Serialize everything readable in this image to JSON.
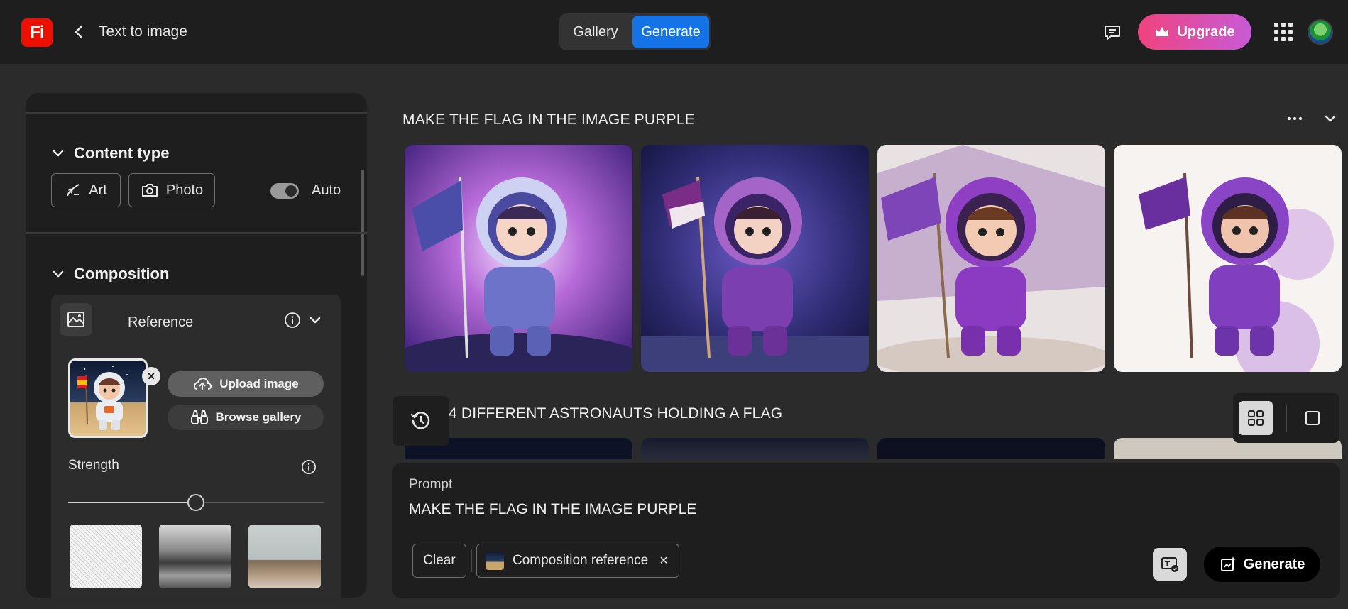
{
  "app": {
    "logo_text": "Fi",
    "page_title": "Text to image",
    "brand_color": "#eb1000",
    "accent_color": "#1473e6"
  },
  "header": {
    "tabs": [
      {
        "label": "Gallery",
        "active": false
      },
      {
        "label": "Generate",
        "active": true
      }
    ],
    "upgrade_label": "Upgrade",
    "icons": [
      "back-chevron-icon",
      "feedback-icon",
      "crown-icon",
      "apps-grid-icon",
      "avatar"
    ]
  },
  "sidebar": {
    "content_type": {
      "heading": "Content type",
      "buttons": [
        {
          "label": "Art",
          "icon": "brush-icon"
        },
        {
          "label": "Photo",
          "icon": "camera-icon"
        }
      ],
      "auto_label": "Auto",
      "auto_enabled": true
    },
    "composition": {
      "heading": "Composition",
      "reference": {
        "title": "Reference",
        "upload_label": "Upload image",
        "browse_label": "Browse gallery"
      },
      "strength": {
        "label": "Strength",
        "value": 0.5
      }
    }
  },
  "results": {
    "rows": [
      {
        "prompt": "MAKE THE FLAG IN THE IMAGE PURPLE"
      },
      {
        "prompt": "4 DIFFERENT ASTRONAUTS HOLDING A FLAG"
      }
    ]
  },
  "prompt_bar": {
    "label": "Prompt",
    "value": "MAKE THE FLAG IN THE IMAGE PURPLE",
    "clear_label": "Clear",
    "chip_label": "Composition reference",
    "generate_label": "Generate"
  }
}
